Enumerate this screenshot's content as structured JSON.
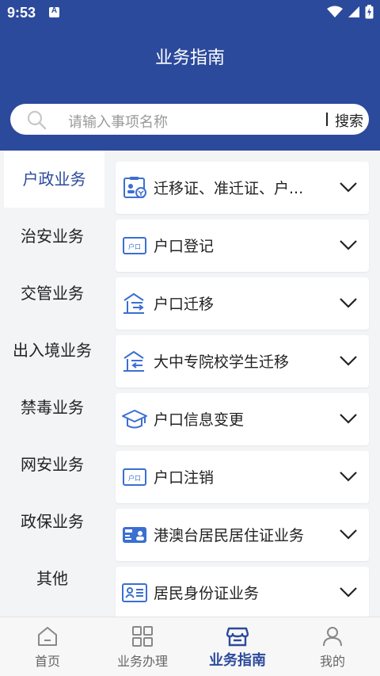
{
  "status_bar": {
    "time": "9:53",
    "notification_letter": "A"
  },
  "header": {
    "title": "业务指南"
  },
  "search": {
    "placeholder": "请输入事项名称",
    "button_label": "搜索"
  },
  "sidebar": {
    "items": [
      {
        "label": "户政业务",
        "active": true
      },
      {
        "label": "治安业务",
        "active": false
      },
      {
        "label": "交管业务",
        "active": false
      },
      {
        "label": "出入境业务",
        "active": false
      },
      {
        "label": "禁毒业务",
        "active": false
      },
      {
        "label": "网安业务",
        "active": false
      },
      {
        "label": "政保业务",
        "active": false
      },
      {
        "label": "其他",
        "active": false
      }
    ]
  },
  "content": {
    "items": [
      {
        "label": "迁移证、准迁证、户...",
        "icon": "id-card-icon"
      },
      {
        "label": "户口登记",
        "icon": "hukou-book-icon"
      },
      {
        "label": "户口迁移",
        "icon": "house-move-in-icon"
      },
      {
        "label": "大中专院校学生迁移",
        "icon": "house-move-out-icon"
      },
      {
        "label": "户口信息变更",
        "icon": "graduation-cap-icon"
      },
      {
        "label": "户口注销",
        "icon": "hukou-book-icon"
      },
      {
        "label": "港澳台居民居住证业务",
        "icon": "residence-permit-icon"
      },
      {
        "label": "居民身份证业务",
        "icon": "identity-card-icon"
      }
    ]
  },
  "tabbar": {
    "items": [
      {
        "label": "首页",
        "icon": "home-icon",
        "active": false
      },
      {
        "label": "业务办理",
        "icon": "grid-icon",
        "active": false
      },
      {
        "label": "业务指南",
        "icon": "shop-guide-icon",
        "active": true
      },
      {
        "label": "我的",
        "icon": "user-icon",
        "active": false
      }
    ]
  },
  "colors": {
    "primary": "#2c4a9c",
    "icon_blue": "#3b6fd1",
    "text": "#222222",
    "muted": "#666666"
  }
}
